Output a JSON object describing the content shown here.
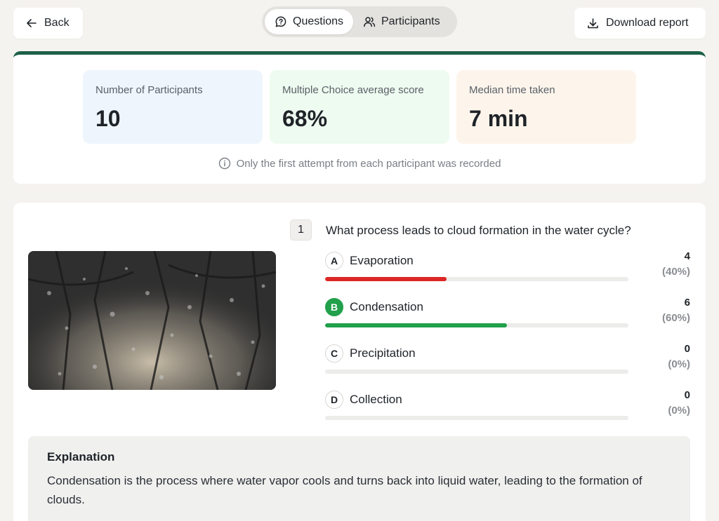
{
  "toolbar": {
    "back_label": "Back",
    "download_label": "Download report",
    "tabs": [
      {
        "label": "Questions",
        "active": true
      },
      {
        "label": "Participants",
        "active": false
      }
    ]
  },
  "stats": [
    {
      "label": "Number of Participants",
      "value": "10"
    },
    {
      "label": "Multiple Choice average score",
      "value": "68%"
    },
    {
      "label": "Median time taken",
      "value": "7 min"
    }
  ],
  "note": "Only the first attempt from each participant was recorded",
  "question": {
    "number": "1",
    "text": "What process leads to cloud formation in the water cycle?",
    "options": [
      {
        "letter": "A",
        "label": "Evaporation",
        "count": "4",
        "percent_label": "(40%)",
        "fraction": 0.4,
        "color": "#dc2626",
        "correct": false
      },
      {
        "letter": "B",
        "label": "Condensation",
        "count": "6",
        "percent_label": "(60%)",
        "fraction": 0.6,
        "color": "#22a04b",
        "correct": true
      },
      {
        "letter": "C",
        "label": "Precipitation",
        "count": "0",
        "percent_label": "(0%)",
        "fraction": 0,
        "color": "#22a04b",
        "correct": false
      },
      {
        "letter": "D",
        "label": "Collection",
        "count": "0",
        "percent_label": "(0%)",
        "fraction": 0,
        "color": "#22a04b",
        "correct": false
      }
    ]
  },
  "explanation": {
    "heading": "Explanation",
    "text": "Condensation is the process where water vapor cools and turns back into liquid water, leading to the formation of clouds."
  },
  "colors": {
    "accent": "#1c6048",
    "correct": "#22a04b",
    "wrong": "#dc2626"
  }
}
